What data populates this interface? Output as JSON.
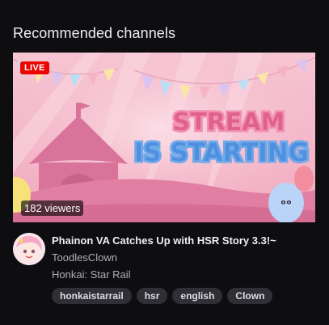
{
  "section": {
    "title": "Recommended channels"
  },
  "stream": {
    "live_label": "LIVE",
    "viewers_label": "182 viewers",
    "thumbnail_text_line1": "STREAM",
    "thumbnail_text_line2": "IS STARTING",
    "title": "Phainon VA Catches Up with HSR Story 3.3!~",
    "channel": "ToodlesClown",
    "category": "Honkai: Star Rail",
    "tags": [
      "honkaistarrail",
      "hsr",
      "english",
      "Clown"
    ]
  },
  "colors": {
    "background": "#0e0e10",
    "live_badge": "#eb0400",
    "tag_background": "#2f2f35",
    "secondary_text": "#adadb8"
  }
}
